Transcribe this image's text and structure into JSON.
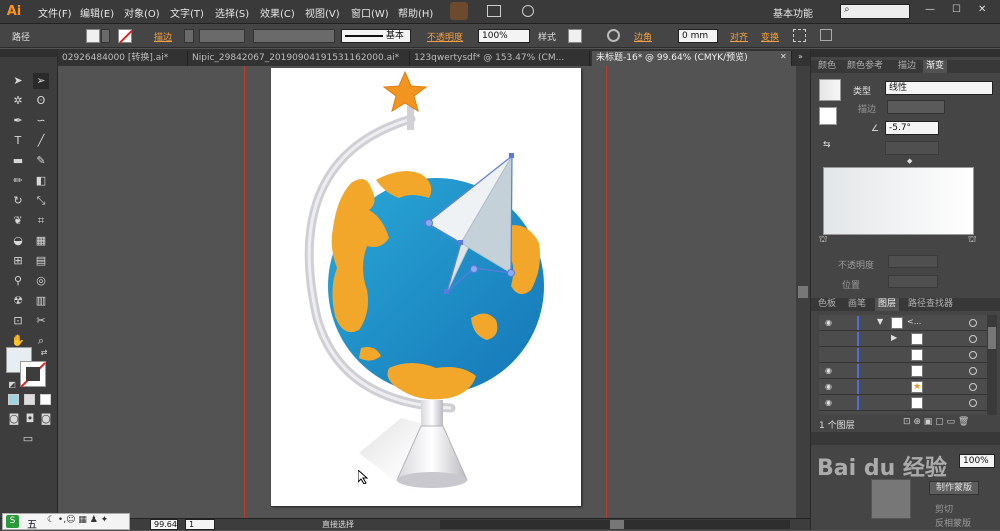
{
  "app": {
    "logo": "Ai",
    "workspace": "基本功能"
  },
  "menu": [
    "文件(F)",
    "编辑(E)",
    "对象(O)",
    "文字(T)",
    "选择(S)",
    "效果(C)",
    "视图(V)",
    "窗口(W)",
    "帮助(H)"
  ],
  "control": {
    "object_type": "路径",
    "stroke_label": "描边",
    "stroke_style": "基本",
    "opacity_label": "不透明度",
    "opacity_value": "100%",
    "style_label": "样式",
    "corner_label": "边角",
    "corner_value": "0 mm",
    "align_label": "对齐",
    "transform_label": "变换"
  },
  "tabs": [
    {
      "label": "02926484000 [转换].ai*",
      "active": false
    },
    {
      "label": "Nipic_29842067_20190904191531162000.ai*",
      "active": false
    },
    {
      "label": "123qwertysdf* @ 153.47% (CM...",
      "active": false
    },
    {
      "label": "未标题-16* @ 99.64% (CMYK/预览)",
      "active": true
    }
  ],
  "gradient_panel": {
    "tabs": [
      "颜色",
      "颜色参考",
      "描边",
      "渐变"
    ],
    "type_label": "类型",
    "type_value": "线性",
    "stroke_label": "描边",
    "angle_value": "-5.7°",
    "opacity_label": "不透明度",
    "position_label": "位置"
  },
  "layers_panel": {
    "tabs": [
      "色板",
      "画笔",
      "图层",
      "路径查找器"
    ],
    "footer_text": "1 个图层",
    "layer_name_preview": "<..."
  },
  "appearance_panel": {
    "opacity_value": "100%",
    "make_mask_button": "制作蒙版",
    "clip_label": "剪切",
    "invert_label": "反相蒙版"
  },
  "status": {
    "zoom": "99.64%",
    "page": "1",
    "tool": "直接选择"
  },
  "ime": {
    "label": "五"
  },
  "watermark": "Bai du 经验",
  "colors": {
    "accent": "#f4a040",
    "globe_blue": "#1e90c8",
    "land_orange": "#f0a020"
  }
}
